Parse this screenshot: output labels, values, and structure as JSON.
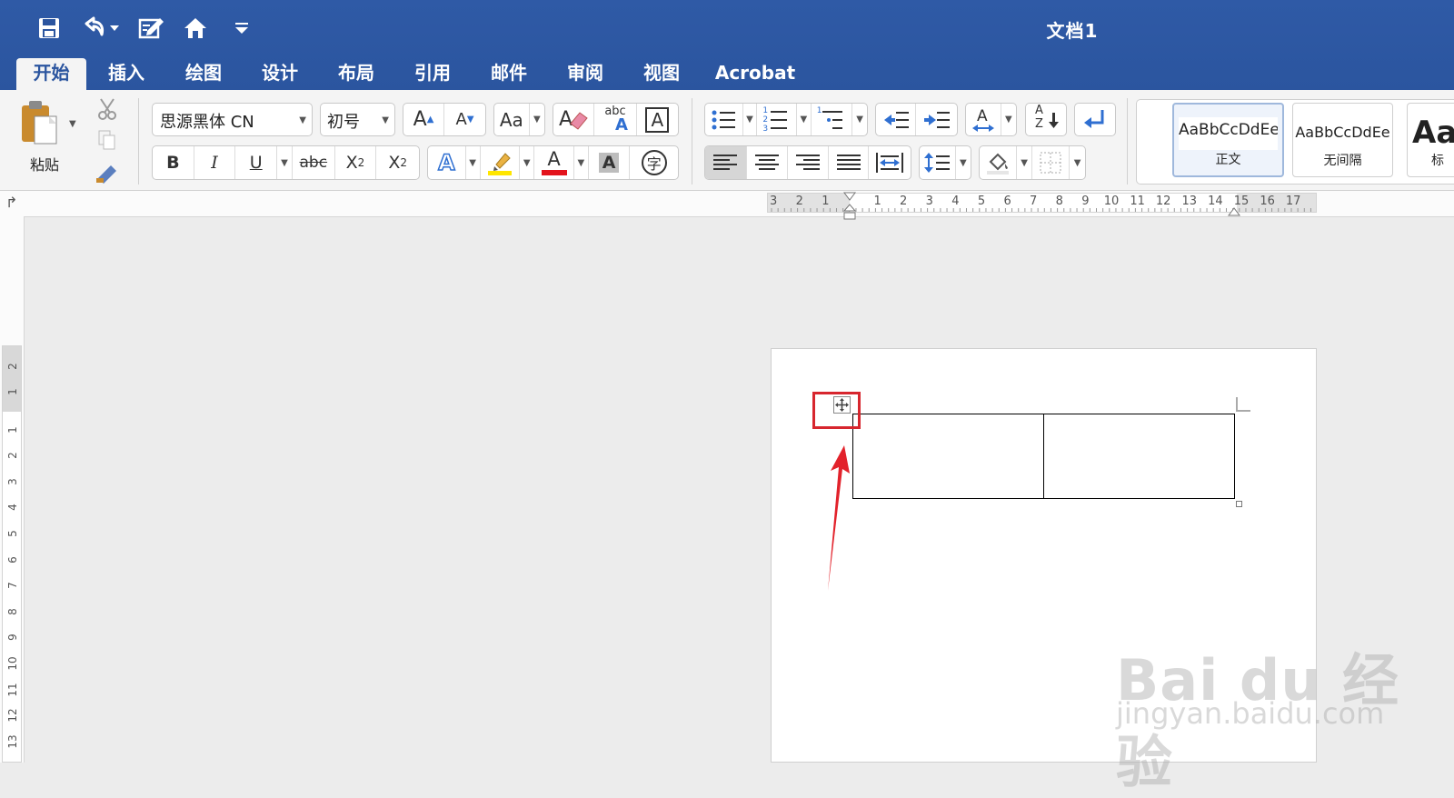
{
  "title_bar": {
    "doc_title": "文档1",
    "quick_access": [
      "save-icon",
      "undo-icon",
      "undo-dropdown-icon",
      "edit-icon",
      "home-icon",
      "customize-dropdown-icon"
    ]
  },
  "tabs": [
    {
      "label": "开始",
      "active": true
    },
    {
      "label": "插入",
      "active": false
    },
    {
      "label": "绘图",
      "active": false
    },
    {
      "label": "设计",
      "active": false
    },
    {
      "label": "布局",
      "active": false
    },
    {
      "label": "引用",
      "active": false
    },
    {
      "label": "邮件",
      "active": false
    },
    {
      "label": "审阅",
      "active": false
    },
    {
      "label": "视图",
      "active": false
    },
    {
      "label": "Acrobat",
      "active": false
    }
  ],
  "ribbon": {
    "paste_label": "粘贴",
    "font_name": "思源黑体 CN",
    "font_size": "初号",
    "bold": "B",
    "italic": "I",
    "underline": "U",
    "strikethrough": "abc",
    "subscript": "X",
    "subscript_mark": "2",
    "superscript": "X",
    "superscript_mark": "2",
    "grow_font": "A",
    "shrink_font": "A",
    "change_case": "Aa",
    "spell": "abc",
    "spell_a": "A",
    "char_border": "A",
    "text_effect": "A",
    "font_color": "A",
    "char_shading": "A",
    "phonetic": "字",
    "sort_a": "A",
    "sort_z": "Z",
    "bullet_numbers": [
      "1",
      "2",
      "3"
    ],
    "multilevel_number": "1",
    "style_gallery": [
      {
        "sample": "AaBbCcDdEe",
        "name": "正文",
        "selected": true
      },
      {
        "sample": "AaBbCcDdEe",
        "name": "无间隔",
        "selected": false
      },
      {
        "sample": "Aa",
        "name": "标",
        "selected": false
      }
    ],
    "colors": {
      "highlight": "#ffe600",
      "font_color": "#e3131c",
      "accent": "#2b559f"
    }
  },
  "hruler": {
    "numbers": [
      "3",
      "2",
      "1",
      "1",
      "2",
      "3",
      "4",
      "5",
      "6",
      "7",
      "8",
      "9",
      "10",
      "11",
      "12",
      "13",
      "14",
      "15",
      "16",
      "17"
    ]
  },
  "vruler": {
    "numbers": [
      "2",
      "1",
      "1",
      "2",
      "3",
      "4",
      "5",
      "6",
      "7",
      "8",
      "9",
      "10",
      "11",
      "12",
      "13"
    ]
  },
  "watermark": {
    "main": "Bai du 经验",
    "sub": "jingyan.baidu.com"
  }
}
